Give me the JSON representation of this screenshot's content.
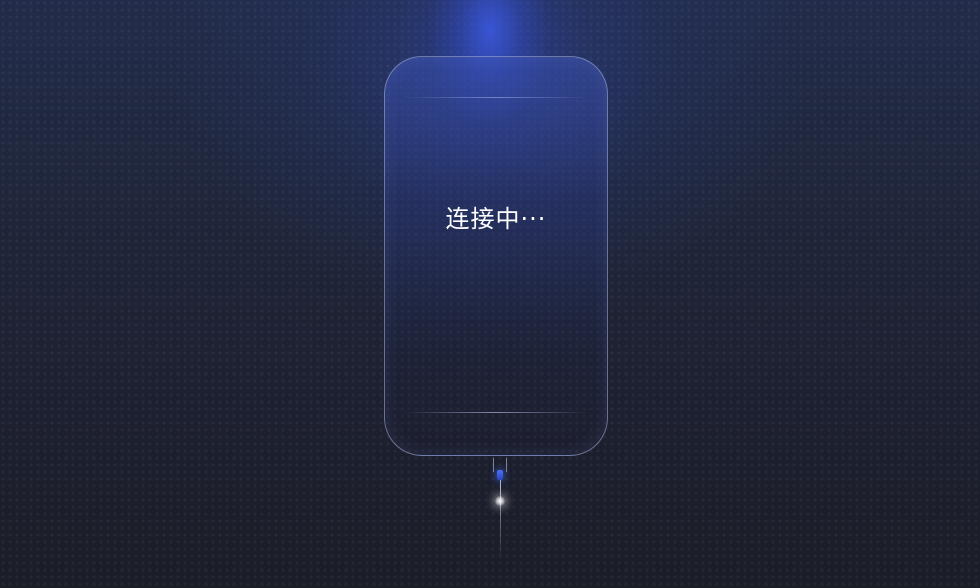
{
  "screen": {
    "status_text": "连接中···"
  },
  "colors": {
    "background": "#1e2130",
    "glow": "#3c5ae6",
    "text": "#ffffff"
  },
  "icons": {
    "device": "phone-outline-icon",
    "cable": "usb-cable-icon"
  }
}
